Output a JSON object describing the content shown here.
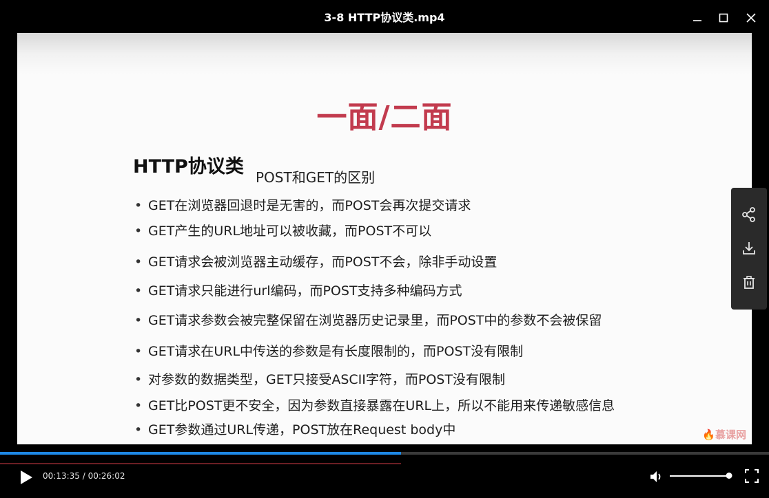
{
  "window": {
    "title": "3-8 HTTP协议类.mp4"
  },
  "slide": {
    "heading": "一面/二面",
    "topic": "HTTP协议类",
    "subtopic": "POST和GET的区别",
    "bullet_symbol": "•",
    "bullets": [
      "GET在浏览器回退时是无害的，而POST会再次提交请求",
      "GET产生的URL地址可以被收藏，而POST不可以",
      "GET请求会被浏览器主动缓存，而POST不会，除非手动设置",
      "GET请求只能进行url编码，而POST支持多种编码方式",
      "GET请求参数会被完整保留在浏览器历史记录里，而POST中的参数不会被保留",
      "GET请求在URL中传送的参数是有长度限制的，而POST没有限制",
      "对参数的数据类型，GET只接受ASCII字符，而POST没有限制",
      "GET比POST更不安全，因为参数直接暴露在URL上，所以不能用来传递敏感信息",
      "GET参数通过URL传递，POST放在Request body中"
    ],
    "watermark": "慕课网",
    "heading_color": "#c23b4e"
  },
  "side_panel": {
    "icons": [
      "share-icon",
      "download-icon",
      "delete-icon"
    ]
  },
  "player": {
    "current_time": "00:13:35",
    "total_time": "00:26:02",
    "time_display": "00:13:35 / 00:26:02",
    "progress_fraction": 0.5218,
    "volume_fraction": 1.0,
    "accent_color": "#1e88e5"
  }
}
